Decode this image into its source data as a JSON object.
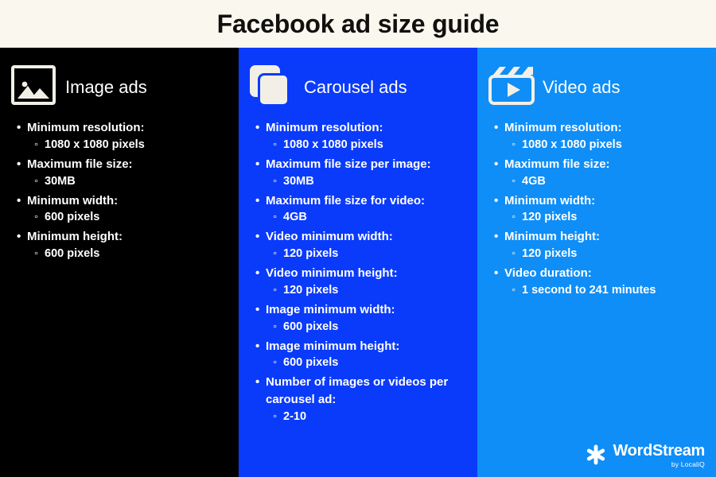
{
  "header": {
    "title": "Facebook ad size guide"
  },
  "columns": [
    {
      "key": "image",
      "title": "Image ads",
      "icon": "image-icon",
      "bg": "#000000",
      "items": [
        {
          "label": "Minimum resolution:",
          "sub": [
            "1080 x 1080 pixels"
          ]
        },
        {
          "label": "Maximum file size:",
          "sub": [
            "30MB"
          ]
        },
        {
          "label": "Minimum width:",
          "sub": [
            "600 pixels"
          ]
        },
        {
          "label": "Minimum height:",
          "sub": [
            "600 pixels"
          ]
        }
      ]
    },
    {
      "key": "carousel",
      "title": "Carousel ads",
      "icon": "carousel-cards-icon",
      "bg": "#0a3bfb",
      "items": [
        {
          "label": "Minimum resolution:",
          "sub": [
            "1080 x 1080 pixels"
          ]
        },
        {
          "label": "Maximum file size per image:",
          "sub": [
            "30MB"
          ]
        },
        {
          "label": "Maximum file size for video:",
          "sub": [
            "4GB"
          ]
        },
        {
          "label": "Video minimum width:",
          "sub": [
            "120 pixels"
          ]
        },
        {
          "label": "Video minimum height:",
          "sub": [
            "120 pixels"
          ]
        },
        {
          "label": "Image minimum width:",
          "sub": [
            "600 pixels"
          ]
        },
        {
          "label": "Image minimum height:",
          "sub": [
            "600 pixels"
          ]
        },
        {
          "label": "Number of images or videos per carousel ad:",
          "sub": [
            "2-10"
          ]
        }
      ]
    },
    {
      "key": "video",
      "title": "Video ads",
      "icon": "video-play-icon",
      "bg": "#0f8ef7",
      "items": [
        {
          "label": "Minimum resolution:",
          "sub": [
            "1080 x 1080 pixels"
          ]
        },
        {
          "label": "Maximum file size:",
          "sub": [
            "4GB"
          ]
        },
        {
          "label": "Minimum width:",
          "sub": [
            "120 pixels"
          ]
        },
        {
          "label": "Minimum height:",
          "sub": [
            "120 pixels"
          ]
        },
        {
          "label": "Video duration:",
          "sub": [
            "1 second to 241 minutes"
          ]
        }
      ]
    }
  ],
  "logo": {
    "name": "WordStream",
    "sub": "by LocaliQ",
    "icon": "asterisk-logo-icon"
  }
}
